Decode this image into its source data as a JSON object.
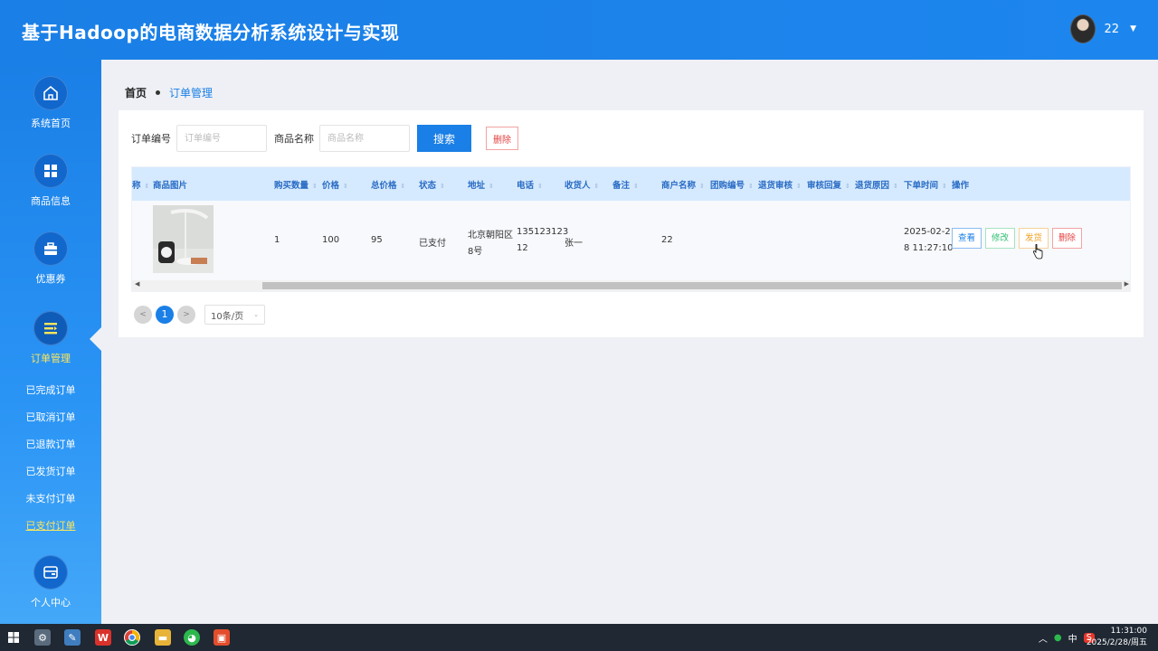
{
  "app": {
    "title": "基于Hadoop的电商数据分析系统设计与实现"
  },
  "user": {
    "name": "22"
  },
  "sidebar": {
    "items": [
      {
        "label": "系统首页",
        "icon": "home-icon"
      },
      {
        "label": "商品信息",
        "icon": "grid-icon"
      },
      {
        "label": "优惠券",
        "icon": "briefcase-icon"
      },
      {
        "label": "订单管理",
        "icon": "list-icon"
      },
      {
        "label": "个人中心",
        "icon": "wallet-icon"
      }
    ],
    "sub_items": [
      "已完成订单",
      "已取消订单",
      "已退款订单",
      "已发货订单",
      "未支付订单",
      "已支付订单"
    ]
  },
  "breadcrumb": {
    "home": "首页",
    "current": "订单管理"
  },
  "search": {
    "order_no_label": "订单编号",
    "order_no_placeholder": "订单编号",
    "product_label": "商品名称",
    "product_placeholder": "商品名称",
    "search_button": "搜索",
    "delete_button": "删除"
  },
  "table": {
    "columns": [
      "称",
      "商品图片",
      "购买数量",
      "价格",
      "总价格",
      "状态",
      "地址",
      "电话",
      "收货人",
      "备注",
      "商户名称",
      "团购编号",
      "退货审核",
      "审核回复",
      "退货原因",
      "下单时间",
      "操作"
    ],
    "rows": [
      {
        "quantity": "1",
        "price": "100",
        "total": "95",
        "status": "已支付",
        "address_l1": "北京朝阳区",
        "address_l2": "8号",
        "phone_l1": "135123123",
        "phone_l2": "12",
        "receiver": "张一",
        "remark": "",
        "merchant": "22",
        "group_no": "",
        "return_review": "",
        "review_reply": "",
        "return_reason": "",
        "time_l1": "2025-02-2",
        "time_l2": "8 11:27:10",
        "actions": {
          "view": "查看",
          "edit": "修改",
          "ship": "发货",
          "delete": "删除"
        }
      }
    ]
  },
  "pagination": {
    "prev": "<",
    "current": "1",
    "next": ">",
    "page_size": "10条/页"
  },
  "taskbar": {
    "ime": "中",
    "time": "11:31:00",
    "date": "2025/2/28/周五"
  },
  "colors": {
    "primary": "#1a7fe6",
    "header_bg": "#d6eaff",
    "danger": "#e54040",
    "success": "#2fbf71",
    "warning": "#f0a020",
    "sidebar_highlight": "#ffe65a"
  }
}
